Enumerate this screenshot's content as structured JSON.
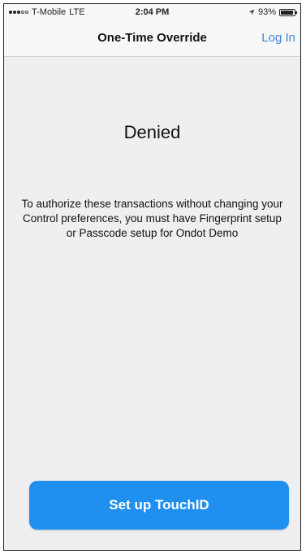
{
  "status_bar": {
    "carrier": "T-Mobile",
    "network": "LTE",
    "time": "2:04 PM",
    "battery_percent": "93%",
    "battery_level": 0.93
  },
  "nav": {
    "title": "One-Time Override",
    "login_label": "Log In"
  },
  "main": {
    "heading": "Denied",
    "message": "To authorize these transactions without changing your Control preferences, you must have Fingerprint setup or Passcode setup for Ondot Demo",
    "button_label": "Set up TouchID"
  },
  "colors": {
    "accent": "#1f8ff0",
    "link": "#3a86d9"
  }
}
